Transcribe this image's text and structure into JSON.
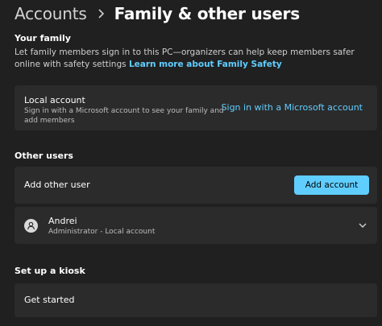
{
  "breadcrumb": {
    "parent": "Accounts",
    "current": "Family & other users"
  },
  "family": {
    "title": "Your family",
    "description": "Let family members sign in to this PC—organizers can help keep members safer online with safety settings",
    "learn_more": "Learn more about Family Safety",
    "local_account": {
      "title": "Local account",
      "subtitle": "Sign in with a Microsoft account to see your family and add members",
      "action": "Sign in with a Microsoft account"
    }
  },
  "other_users": {
    "title": "Other users",
    "add_label": "Add other user",
    "add_button": "Add account",
    "users": [
      {
        "name": "Andrei",
        "role": "Administrator - Local account"
      }
    ]
  },
  "kiosk": {
    "title": "Set up a kiosk",
    "action": "Get started"
  },
  "colors": {
    "accent": "#60cdff",
    "background": "#202020",
    "card": "#2b2b2b"
  }
}
